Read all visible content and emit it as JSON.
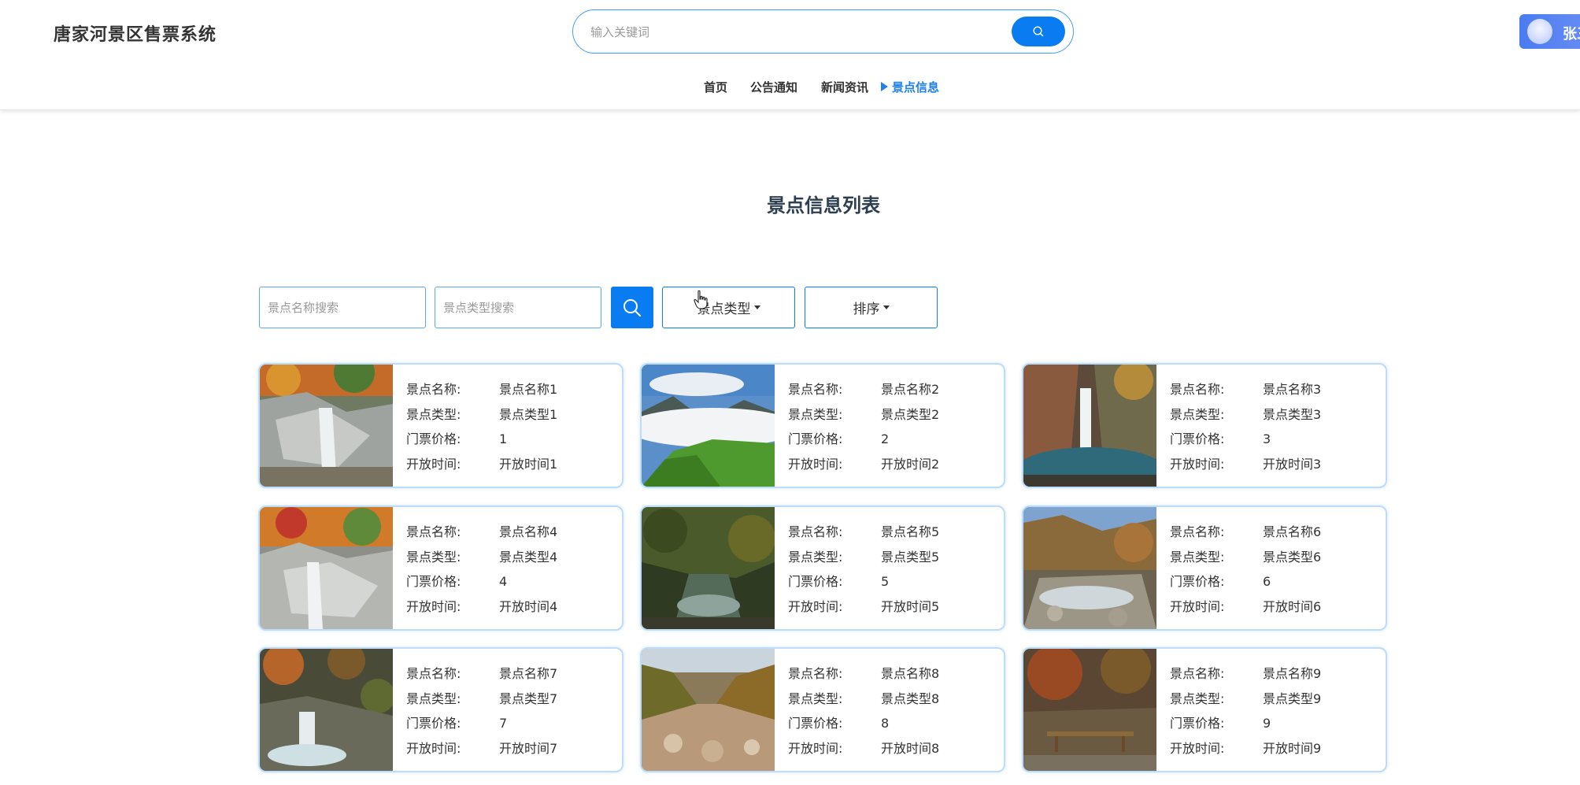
{
  "header": {
    "site_title": "唐家河景区售票系统",
    "search_placeholder": "输入关键词",
    "user_name": "张三"
  },
  "nav": {
    "items": [
      {
        "label": "首页",
        "active": false
      },
      {
        "label": "公告通知",
        "active": false
      },
      {
        "label": "新闻资讯",
        "active": false
      },
      {
        "label": "景点信息",
        "active": true
      }
    ]
  },
  "page": {
    "heading": "景点信息列表"
  },
  "filters": {
    "name_placeholder": "景点名称搜索",
    "type_placeholder": "景点类型搜索",
    "type_dropdown": "景点类型",
    "sort_dropdown": "排序"
  },
  "labels": {
    "name": "景点名称:",
    "type": "景点类型:",
    "price": "门票价格:",
    "time": "开放时间:"
  },
  "spots": [
    {
      "name": "景点名称1",
      "type": "景点类型1",
      "price": "1",
      "time": "开放时间1"
    },
    {
      "name": "景点名称2",
      "type": "景点类型2",
      "price": "2",
      "time": "开放时间2"
    },
    {
      "name": "景点名称3",
      "type": "景点类型3",
      "price": "3",
      "time": "开放时间3"
    },
    {
      "name": "景点名称4",
      "type": "景点类型4",
      "price": "4",
      "time": "开放时间4"
    },
    {
      "name": "景点名称5",
      "type": "景点类型5",
      "price": "5",
      "time": "开放时间5"
    },
    {
      "name": "景点名称6",
      "type": "景点类型6",
      "price": "6",
      "time": "开放时间6"
    },
    {
      "name": "景点名称7",
      "type": "景点类型7",
      "price": "7",
      "time": "开放时间7"
    },
    {
      "name": "景点名称8",
      "type": "景点类型8",
      "price": "8",
      "time": "开放时间8"
    },
    {
      "name": "景点名称9",
      "type": "景点类型9",
      "price": "9",
      "time": "开放时间9"
    }
  ],
  "colors": {
    "accent": "#0a7cf2",
    "nav_active": "#1e82e8",
    "card_border": "#bddcfa"
  }
}
